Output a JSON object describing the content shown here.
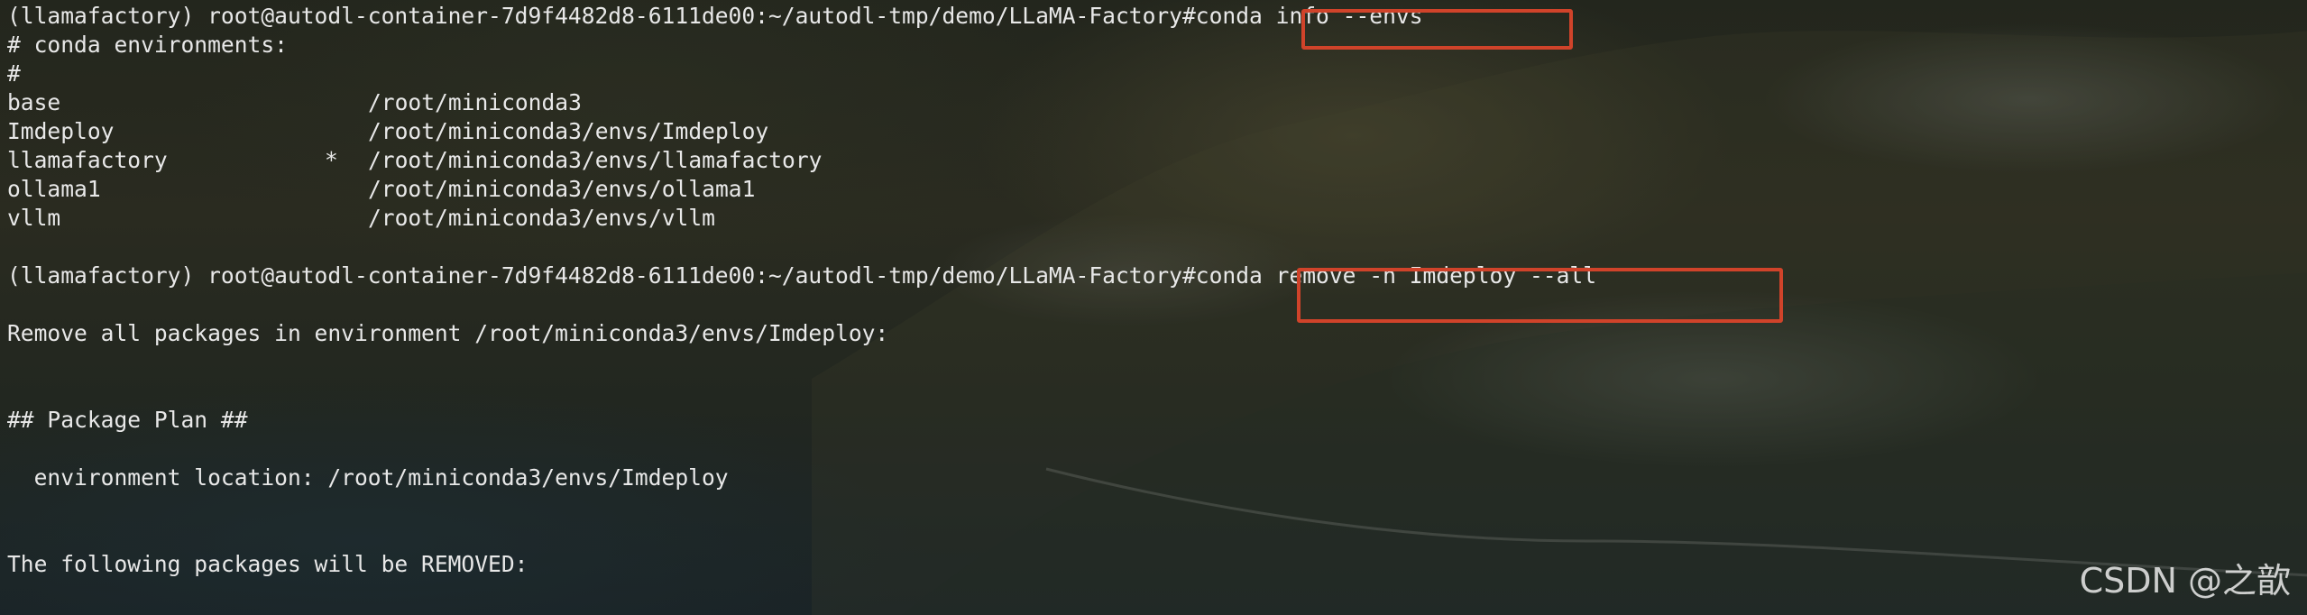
{
  "terminal": {
    "prompt": "(llamafactory) root@autodl-container-7d9f4482d8-6111de00:~/autodl-tmp/demo/LLaMA-Factory#",
    "cmd1": "conda info --envs",
    "header1": "# conda environments:",
    "header2": "#",
    "envs": [
      {
        "name": "base",
        "active": "",
        "path": "/root/miniconda3"
      },
      {
        "name": "Imdeploy",
        "active": "",
        "path": "/root/miniconda3/envs/Imdeploy"
      },
      {
        "name": "llamafactory",
        "active": "*",
        "path": "/root/miniconda3/envs/llamafactory"
      },
      {
        "name": "ollama1",
        "active": "",
        "path": "/root/miniconda3/envs/ollama1"
      },
      {
        "name": "vllm",
        "active": "",
        "path": "/root/miniconda3/envs/vllm"
      }
    ],
    "cmd2": "conda remove -n Imdeploy --all",
    "remove_msg": "Remove all packages in environment /root/miniconda3/envs/Imdeploy:",
    "plan_header": "## Package Plan ##",
    "env_location": "  environment location: /root/miniconda3/envs/Imdeploy",
    "removed_msg": "The following packages will be REMOVED:"
  },
  "watermark": "CSDN @之歆",
  "colors": {
    "text": "#e8e8e8",
    "highlight": "#d0432a"
  }
}
